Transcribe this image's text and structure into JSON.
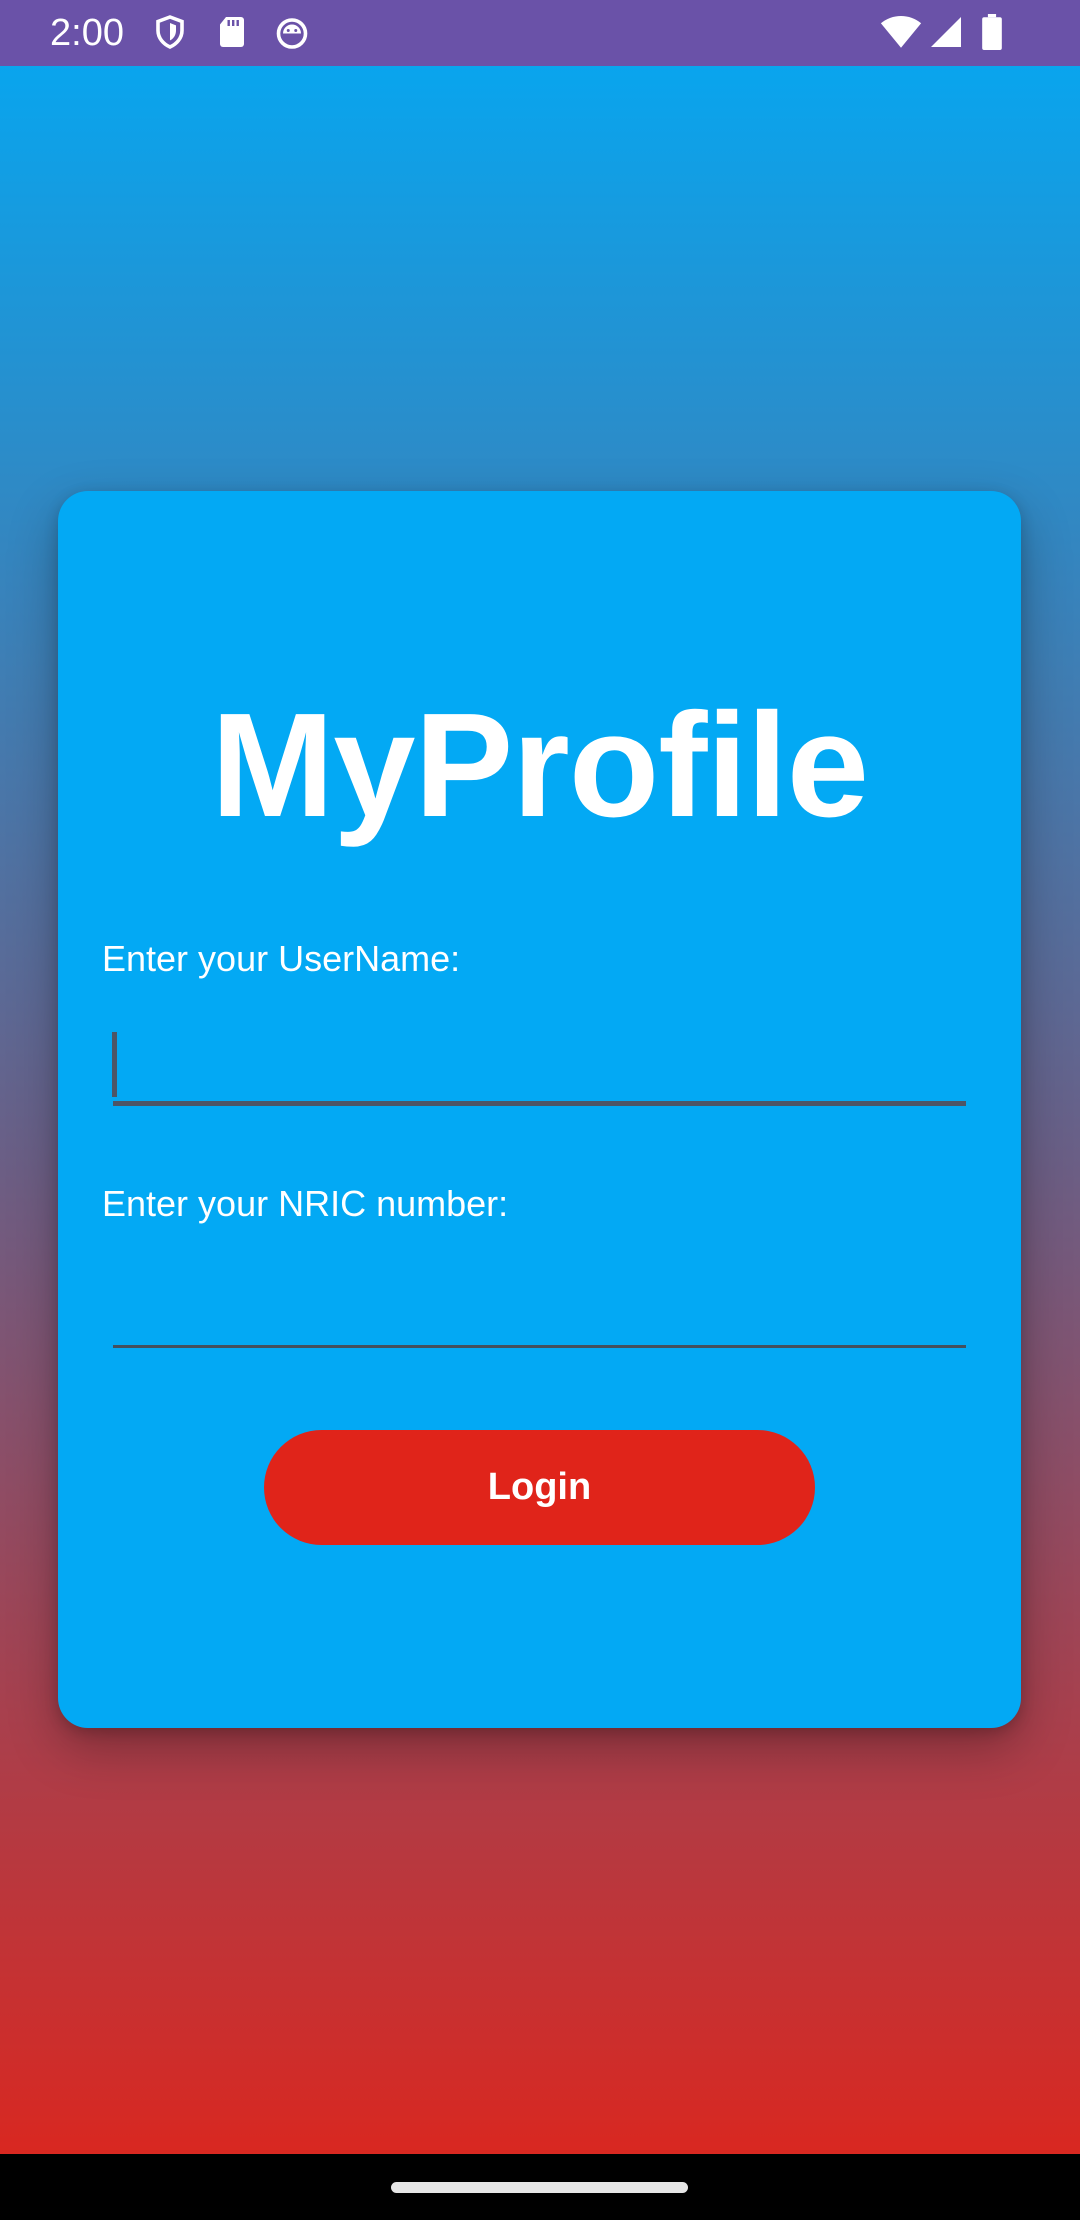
{
  "status_bar": {
    "time": "2:00",
    "left_icons": [
      "shield-icon",
      "sd-card-icon",
      "android-debug-icon"
    ],
    "right_icons": [
      "wifi-icon",
      "cell-signal-icon",
      "battery-icon"
    ],
    "background": "#6A52A8"
  },
  "app": {
    "title": "MyProfile",
    "card_color": "#03A9F4",
    "gradient_top": "#03A9F4",
    "gradient_bottom": "#E0241A"
  },
  "form": {
    "username_label": "Enter your UserName:",
    "username_value": "",
    "nric_label": "Enter your NRIC number:",
    "nric_value": "",
    "login_label": "Login",
    "login_color": "#E0241A"
  }
}
